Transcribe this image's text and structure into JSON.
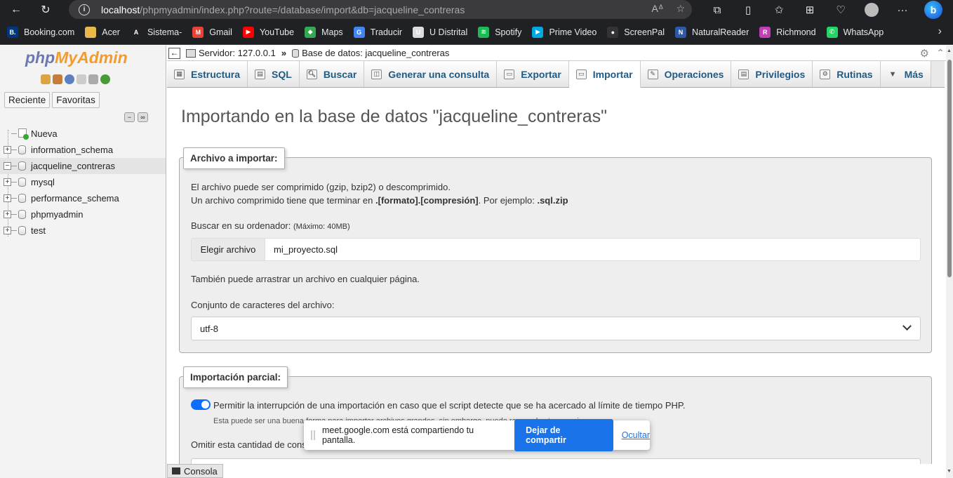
{
  "browser": {
    "url_host": "localhost",
    "url_path": "/phpmyadmin/index.php?route=/database/import&db=jacqueline_contreras",
    "bing_label": "b"
  },
  "bookmarks": [
    {
      "label": "Booking.com",
      "icon": "booking-icon",
      "color": "#003580",
      "glyph": "B."
    },
    {
      "label": "Acer",
      "icon": "folder-icon",
      "color": "#e8b84a",
      "glyph": ""
    },
    {
      "label": "Sistema-",
      "icon": "sistema-icon",
      "color": "#222222",
      "glyph": "A"
    },
    {
      "label": "Gmail",
      "icon": "gmail-icon",
      "color": "#ea4335",
      "glyph": "M"
    },
    {
      "label": "YouTube",
      "icon": "youtube-icon",
      "color": "#ff0000",
      "glyph": "▶"
    },
    {
      "label": "Maps",
      "icon": "maps-icon",
      "color": "#34a853",
      "glyph": "◆"
    },
    {
      "label": "Traducir",
      "icon": "translate-icon",
      "color": "#4285f4",
      "glyph": "G"
    },
    {
      "label": "U Distrital",
      "icon": "udistrital-icon",
      "color": "#dddddd",
      "glyph": "U"
    },
    {
      "label": "Spotify",
      "icon": "spotify-icon",
      "color": "#1db954",
      "glyph": "≋"
    },
    {
      "label": "Prime Video",
      "icon": "primevideo-icon",
      "color": "#00a8e1",
      "glyph": "▶"
    },
    {
      "label": "ScreenPal",
      "icon": "screenpal-icon",
      "color": "#333333",
      "glyph": "●"
    },
    {
      "label": "NaturalReader",
      "icon": "naturalreader-icon",
      "color": "#2d5aa8",
      "glyph": "N"
    },
    {
      "label": "Richmond",
      "icon": "richmond-icon",
      "color": "#c23fb5",
      "glyph": "R"
    },
    {
      "label": "WhatsApp",
      "icon": "whatsapp-icon",
      "color": "#25d366",
      "glyph": "✆"
    }
  ],
  "sidebar": {
    "logo_php": "php",
    "logo_myadmin": "MyAdmin",
    "tab_recent": "Reciente",
    "tab_favorites": "Favoritas",
    "new_label": "Nueva",
    "databases": [
      {
        "name": "information_schema",
        "expander": "+"
      },
      {
        "name": "jacqueline_contreras",
        "expander": "−"
      },
      {
        "name": "mysql",
        "expander": "+"
      },
      {
        "name": "performance_schema",
        "expander": "+"
      },
      {
        "name": "phpmyadmin",
        "expander": "+"
      },
      {
        "name": "test",
        "expander": "+"
      }
    ]
  },
  "breadcrumb": {
    "server": "Servidor: 127.0.0.1",
    "separator": "»",
    "database": "Base de datos: jacqueline_contreras"
  },
  "tabs": [
    {
      "label": "Estructura",
      "icon": "structure-icon"
    },
    {
      "label": "SQL",
      "icon": "sql-icon"
    },
    {
      "label": "Buscar",
      "icon": "search-icon"
    },
    {
      "label": "Generar una consulta",
      "icon": "query-icon"
    },
    {
      "label": "Exportar",
      "icon": "export-icon"
    },
    {
      "label": "Importar",
      "icon": "import-icon",
      "active": true
    },
    {
      "label": "Operaciones",
      "icon": "wrench-icon"
    },
    {
      "label": "Privilegios",
      "icon": "privileges-icon"
    },
    {
      "label": "Rutinas",
      "icon": "routines-icon"
    },
    {
      "label": "Más",
      "icon": "more-icon"
    }
  ],
  "main": {
    "title": "Importando en la base de datos \"jacqueline_contreras\"",
    "file_section": {
      "legend": "Archivo a importar:",
      "line1": "El archivo puede ser comprimido (gzip, bzip2) o descomprimido.",
      "line2_pre": "Un archivo comprimido tiene que terminar en ",
      "line2_bold": ".[formato].[compresión]",
      "line2_mid": ". Por ejemplo: ",
      "line2_example": ".sql.zip",
      "browse_label": "Buscar en su ordenador:",
      "browse_max": "(Máximo: 40MB)",
      "choose_button": "Elegir archivo",
      "chosen_file": "mi_proyecto.sql",
      "drag_hint": "También puede arrastrar un archivo en cualquier página.",
      "charset_label": "Conjunto de caracteres del archivo:",
      "charset_value": "utf-8"
    },
    "partial_section": {
      "legend": "Importación parcial:",
      "interrupt_label": "Permitir la interrupción de una importación en caso que el script detecte que se ha acercado al límite de tiempo PHP.",
      "interrupt_note": "Esta puede ser una buena forma para importar archivos grandes, sin embargo, puede romper las transacciones.",
      "skip_label": "Omitir esta cantidad de consultas (en SQL) desde la primera:"
    }
  },
  "console_label": "Consola",
  "share_bar": {
    "message": "meet.google.com está compartiendo tu pantalla.",
    "stop_button": "Dejar de compartir",
    "hide_link": "Ocultar"
  }
}
